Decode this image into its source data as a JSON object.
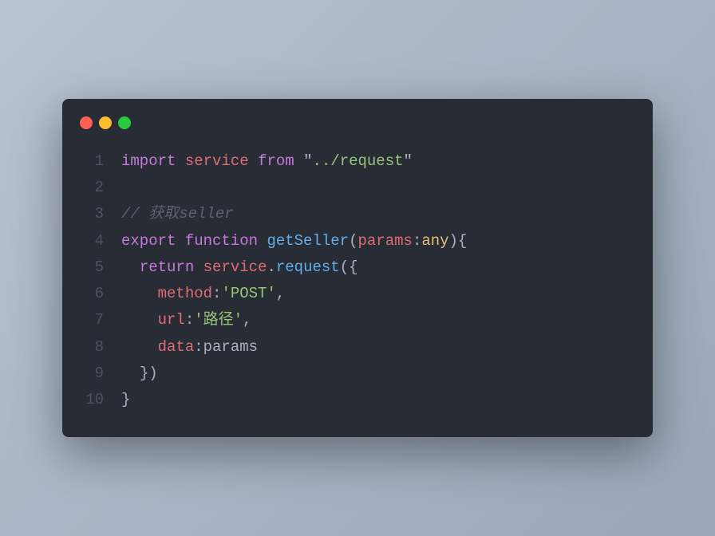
{
  "titlebar": {
    "red": "red",
    "yellow": "yellow",
    "green": "green"
  },
  "code": {
    "lines": [
      {
        "num": "1"
      },
      {
        "num": "2"
      },
      {
        "num": "3"
      },
      {
        "num": "4"
      },
      {
        "num": "5"
      },
      {
        "num": "6"
      },
      {
        "num": "7"
      },
      {
        "num": "8"
      },
      {
        "num": "9"
      },
      {
        "num": "10"
      }
    ],
    "line1": {
      "import": "import",
      "service": "service",
      "from": "from",
      "q1": "\"",
      "path": "../request",
      "q2": "\""
    },
    "line3": {
      "comment": "// 获取seller"
    },
    "line4": {
      "export": "export",
      "function": "function",
      "name": "getSeller",
      "lparen": "(",
      "param": "params",
      "colon": ":",
      "type": "any",
      "rparen_brace": "){"
    },
    "line5": {
      "return": "return",
      "obj": "service",
      "dot": ".",
      "method": "request",
      "open": "({"
    },
    "line6": {
      "key": "method",
      "colon": ":",
      "val": "'POST'",
      "comma": ","
    },
    "line7": {
      "key": "url",
      "colon": ":",
      "val": "'路径'",
      "comma": ","
    },
    "line8": {
      "key": "data",
      "colon": ":",
      "val": "params"
    },
    "line9": {
      "close": "})"
    },
    "line10": {
      "brace": "}"
    }
  }
}
